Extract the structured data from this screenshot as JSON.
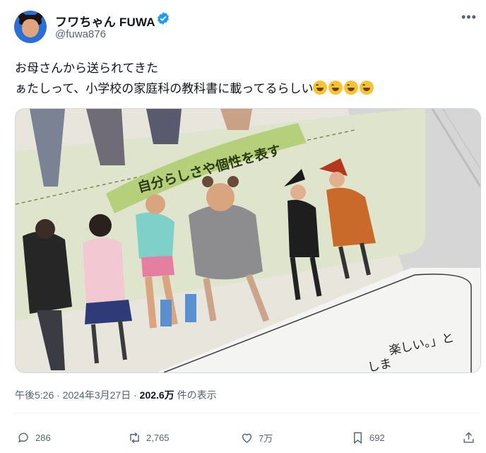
{
  "author": {
    "display_name": "フワちゃん FUWA",
    "handle": "@fuwa876"
  },
  "tweet": {
    "line1": "お母さんから送られてきた",
    "line2": "ぁたしって、小学校の家庭科の教科書に載ってるらしい",
    "emoji_count": 4,
    "emoji_icon": "rolling-on-floor-laughing-icon"
  },
  "media": {
    "banner_text": "自分らしさや個性を表す",
    "page_text_1": "楽しい。」と",
    "page_text_2": "しま"
  },
  "meta": {
    "time": "午後5:26",
    "sep1": "·",
    "date": "2024年3月27日",
    "sep2": "·",
    "views": "202.6万",
    "views_label": " 件の表示"
  },
  "actions": {
    "replies": "286",
    "reposts": "2,765",
    "likes": "7万",
    "bookmarks": "692"
  },
  "colors": {
    "verified": "#1d9bf0",
    "muted_text": "#536471",
    "banner_green": "#b6cf7a",
    "page_panel": "#dde6c4"
  }
}
